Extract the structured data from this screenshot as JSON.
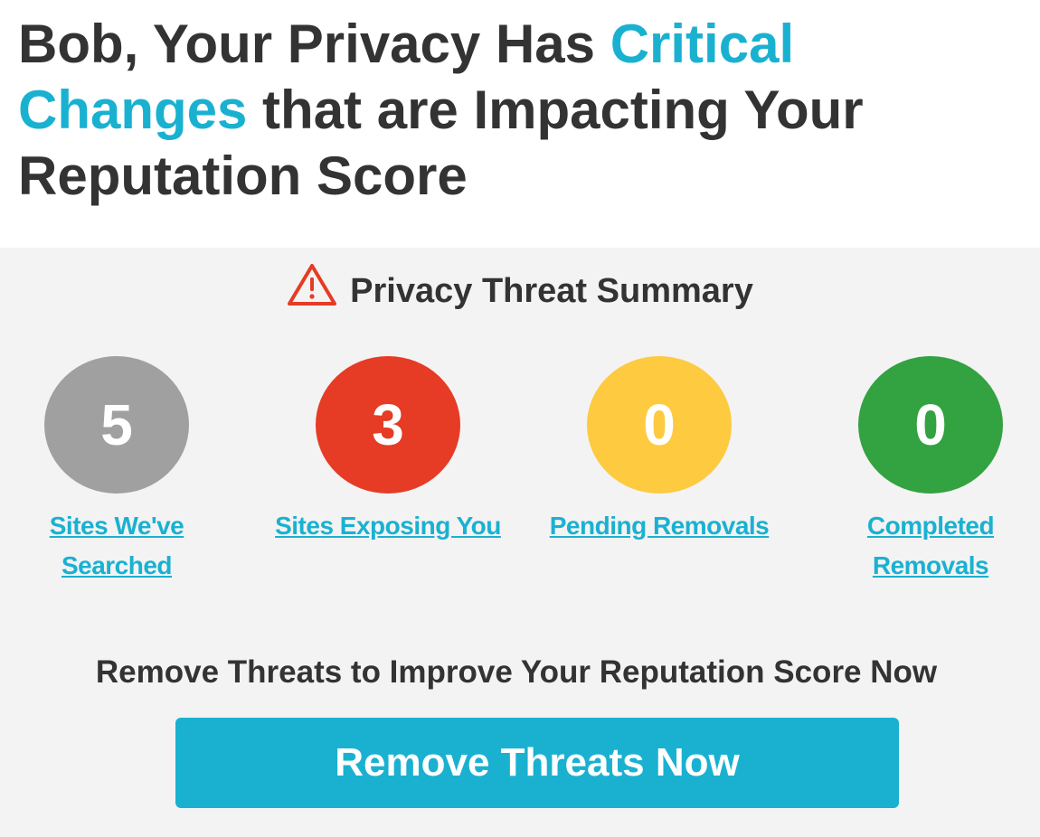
{
  "headline": {
    "part1": "Bob, Your Privacy Has ",
    "accent": "Critical Changes",
    "part2": " that are Impacting Your Reputation Score"
  },
  "summary": {
    "title": "Privacy Threat Summary",
    "icon": "warning-triangle-icon"
  },
  "stats": [
    {
      "value": "5",
      "label_line1": "Sites We've",
      "label_line2": "Searched",
      "color": "#a0a0a0"
    },
    {
      "value": "3",
      "label_line1": "Sites Exposing You",
      "label_line2": "",
      "color": "#e63b24"
    },
    {
      "value": "0",
      "label_line1": "Pending Removals",
      "label_line2": "",
      "color": "#fdca40"
    },
    {
      "value": "0",
      "label_line1": "Completed",
      "label_line2": "Removals",
      "color": "#33a241"
    }
  ],
  "cta": {
    "text": "Remove Threats to Improve Your Reputation Score Now",
    "button_label": "Remove Threats Now"
  },
  "colors": {
    "accent": "#1ab1d1",
    "text": "#333333",
    "panel_bg": "#f3f3f3",
    "warning": "#e63b24"
  }
}
